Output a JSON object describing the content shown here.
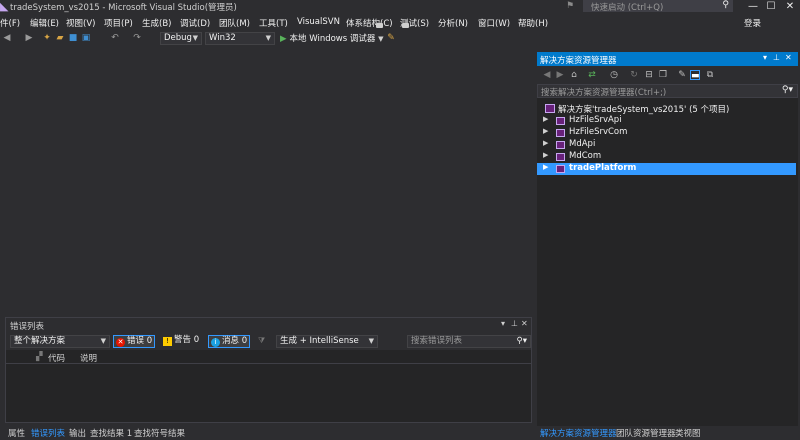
{
  "window": {
    "title": "tradeSystem_vs2015 - Microsoft Visual Studio(管理员)",
    "quick_launch_placeholder": "快速启动 (Ctrl+Q)",
    "controls": {
      "minimize": "—",
      "maximize": "☐",
      "close": "✕"
    }
  },
  "menu": {
    "items": [
      "件(F)",
      "编辑(E)",
      "视图(V)",
      "项目(P)",
      "生成(B)",
      "调试(D)",
      "团队(M)",
      "工具(T)",
      "VisualSVN",
      "体系结构(C)",
      "测试(S)",
      "分析(N)",
      "窗口(W)",
      "帮助(H)"
    ],
    "login": "登录"
  },
  "toolbar": {
    "configuration": "Debug",
    "platform": "Win32",
    "run_label": "本地 Windows 调试器"
  },
  "error_list": {
    "title": "错误列表",
    "scope": "整个解决方案",
    "errors_label": "错误 0",
    "warnings_label": "警告 0",
    "messages_label": "消息 0",
    "build_filter": "生成 + IntelliSense",
    "search_placeholder": "搜索错误列表",
    "columns": [
      "代码",
      "说明"
    ]
  },
  "bottom_tabs": [
    "属性",
    "错误列表",
    "输出",
    "查找结果 1",
    "查找符号结果"
  ],
  "solution_explorer": {
    "title": "解决方案资源管理器",
    "search_placeholder": "搜索解决方案资源管理器(Ctrl+;)",
    "root": "解决方案'tradeSystem_vs2015' (5 个项目)",
    "projects": [
      "HzFileSrvApi",
      "HzFileSrvCom",
      "MdApi",
      "MdCom",
      "tradePlatform"
    ],
    "selected_project": "tradePlatform"
  },
  "solution_tabs": [
    "解决方案资源管理器",
    "团队资源管理器",
    "类视图"
  ],
  "colors": {
    "accent": "#007acc",
    "selection": "#3399ff",
    "background": "#2d2d30",
    "error": "#e51400",
    "warning": "#ffcc00",
    "info": "#1ba1e2"
  }
}
